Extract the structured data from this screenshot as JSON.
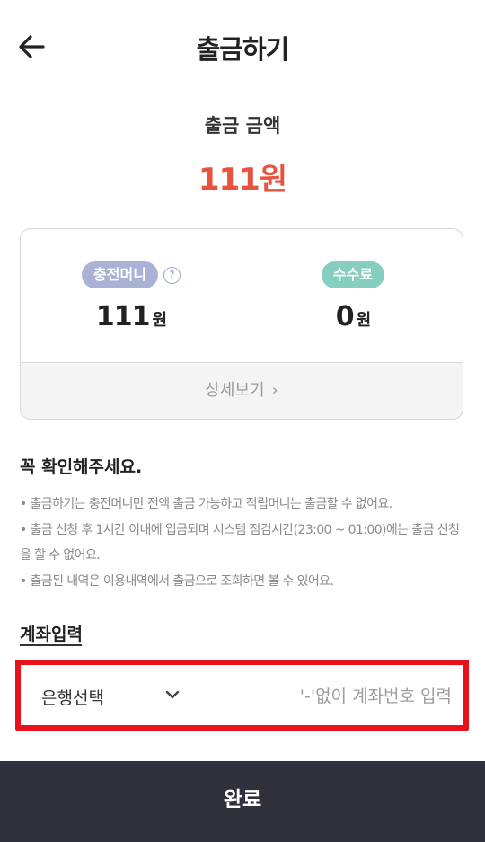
{
  "header": {
    "title": "출금하기",
    "back_icon": "arrow-left-icon"
  },
  "amount": {
    "label": "출금 금액",
    "value": "111원",
    "color": "#e8533f"
  },
  "summary": {
    "charge_label": "충전머니",
    "charge_value": "111",
    "charge_unit": "원",
    "fee_label": "수수료",
    "fee_value": "0",
    "fee_unit": "원",
    "detail_link": "상세보기",
    "detail_chevron": "›"
  },
  "notice": {
    "title": "꼭 확인해주세요.",
    "items": [
      "• 출금하기는 충전머니만 전액 출금 가능하고 적립머니는 출금할 수 없어요.",
      "• 출금 신청 후 1시간 이내에 입금되며 시스템 점검시간(23:00 ~ 01:00)에는 출금 신청을 할 수 없어요.",
      "• 출금된 내역은 이용내역에서 출금으로 조회하면 볼 수 있어요."
    ]
  },
  "account": {
    "title": "계좌입력",
    "bank_select": "은행선택",
    "account_placeholder": "'-'없이 계좌번호 입력",
    "account_value": ""
  },
  "footer": {
    "submit_label": "완료"
  },
  "colors": {
    "accent_red": "#e8533f",
    "highlight_border": "#e8121c",
    "button_bg": "#2f323d"
  }
}
